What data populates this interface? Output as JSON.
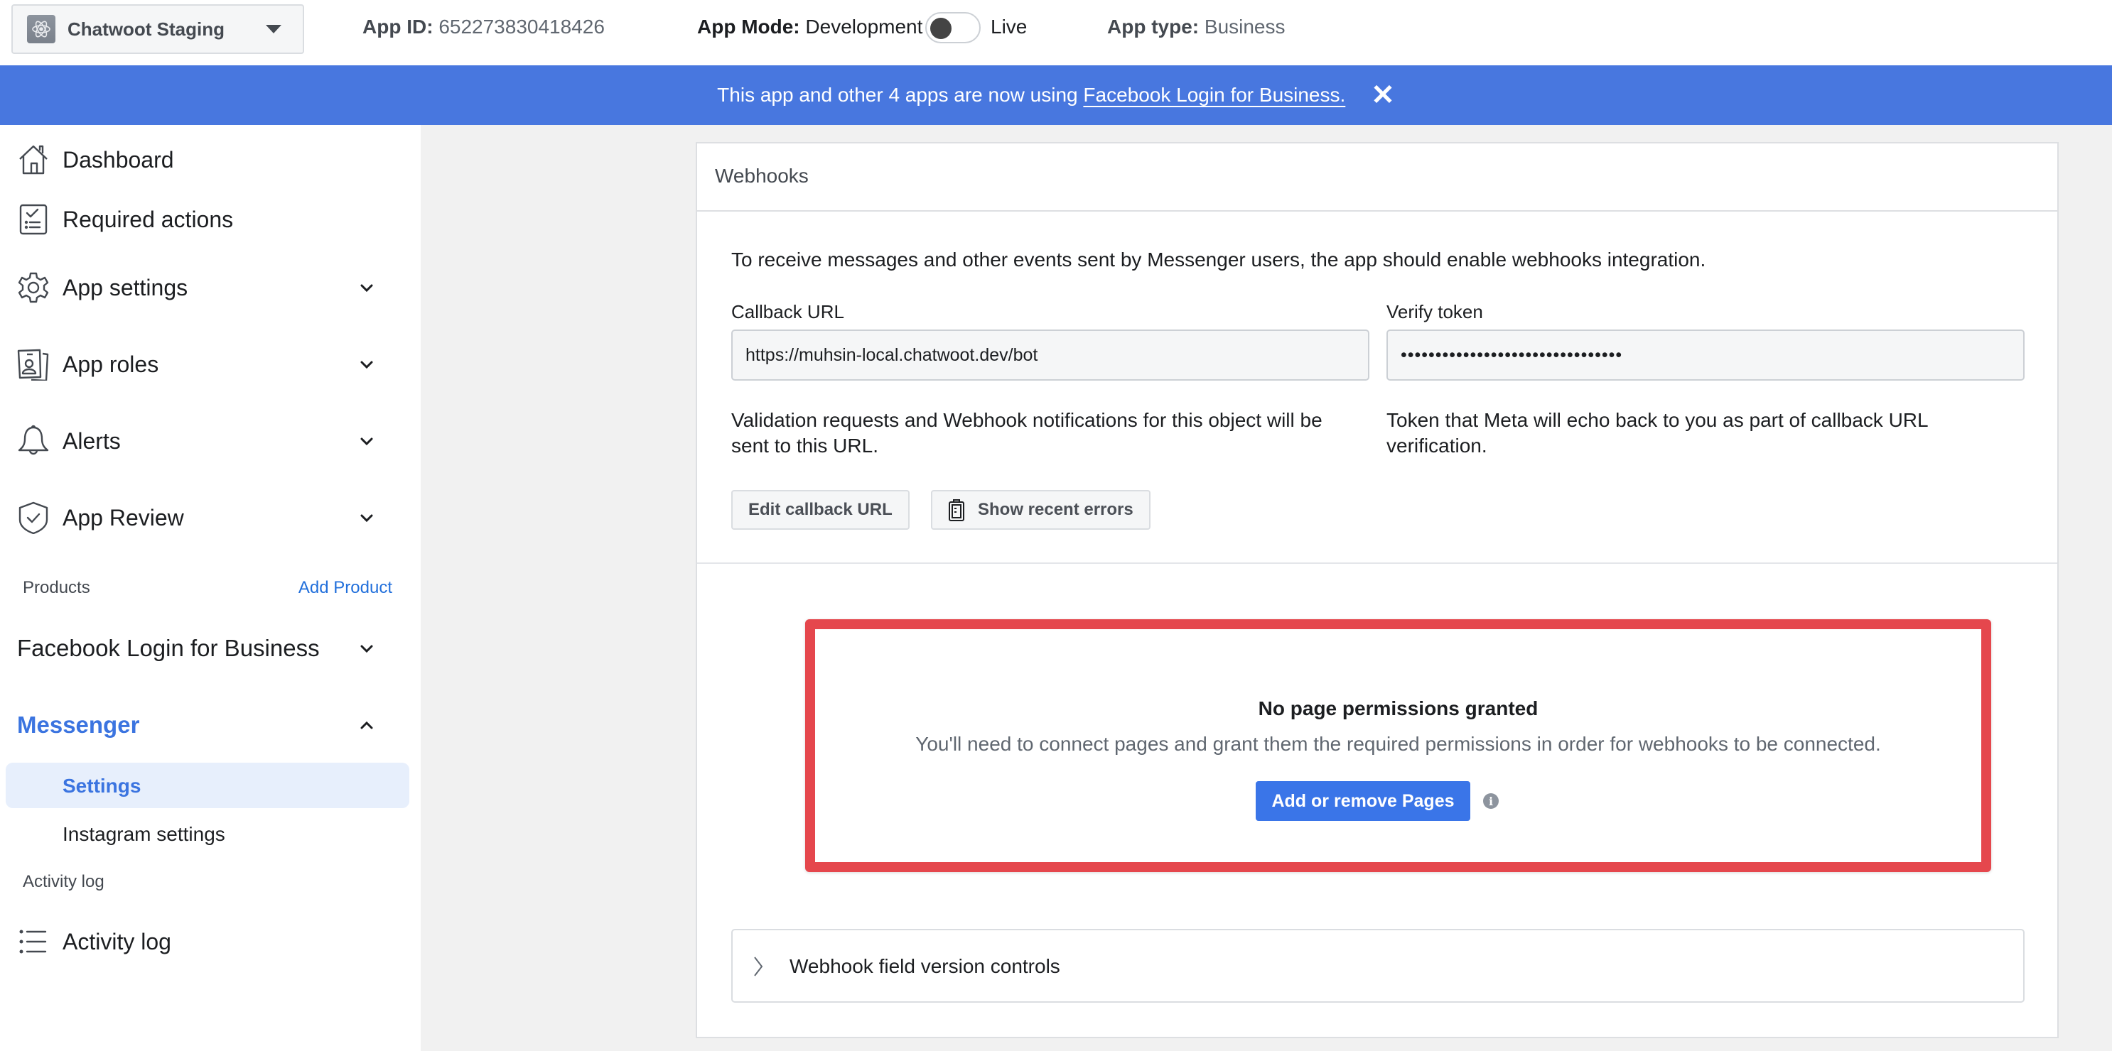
{
  "topbar": {
    "app_name": "Chatwoot Staging",
    "app_id_label": "App ID:",
    "app_id_value": "652273830418426",
    "app_mode_label": "App Mode:",
    "app_mode_value": "Development",
    "mode_toggle_state": "off",
    "live_label": "Live",
    "app_type_label": "App type:",
    "app_type_value": "Business"
  },
  "banner": {
    "text": "This app and other 4 apps are now using ",
    "link_text": "Facebook Login for Business.",
    "close_glyph": "✕",
    "color": "#4877df"
  },
  "sidebar": {
    "items": [
      {
        "label": "Dashboard",
        "icon": "home-icon"
      },
      {
        "label": "Required actions",
        "icon": "checklist-icon"
      },
      {
        "label": "App settings",
        "icon": "gear-icon",
        "expandable": true
      },
      {
        "label": "App roles",
        "icon": "id-badge-icon",
        "expandable": true
      },
      {
        "label": "Alerts",
        "icon": "bell-icon",
        "expandable": true
      },
      {
        "label": "App Review",
        "icon": "shield-check-icon",
        "expandable": true
      }
    ],
    "products_label": "Products",
    "add_product_label": "Add Product",
    "products": [
      {
        "label": "Facebook Login for Business",
        "expanded": false
      },
      {
        "label": "Messenger",
        "expanded": true,
        "active": true
      }
    ],
    "messenger_subitems": [
      {
        "label": "Settings",
        "active": true
      },
      {
        "label": "Instagram settings",
        "active": false
      }
    ],
    "activity_section_label": "Activity log",
    "activity_item": {
      "label": "Activity log",
      "icon": "list-icon"
    },
    "accent_color": "#3b74e0"
  },
  "webhooks": {
    "title": "Webhooks",
    "intro": "To receive messages and other events sent by Messenger users, the app should enable webhooks integration.",
    "callback_label": "Callback URL",
    "callback_value": "https://muhsin-local.chatwoot.dev/bot",
    "verify_label": "Verify token",
    "verify_value": "••••••••••••••••••••••••••••••••",
    "callback_help": "Validation requests and Webhook notifications for this object will be sent to this URL.",
    "verify_help": "Token that Meta will echo back to you as part of callback URL verification.",
    "edit_button": "Edit callback URL",
    "errors_button": "Show recent errors"
  },
  "permissions": {
    "title": "No page permissions granted",
    "message": "You'll need to connect pages and grant them the required permissions in order for webhooks to be connected.",
    "button": "Add or remove Pages",
    "info_glyph": "i",
    "highlight_color": "#e5474d"
  },
  "version_controls": {
    "label": "Webhook field version controls"
  }
}
